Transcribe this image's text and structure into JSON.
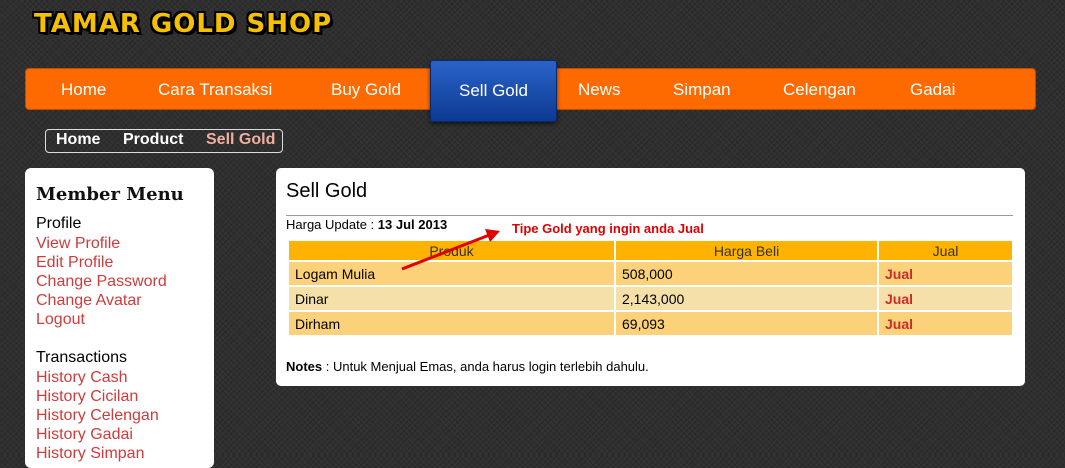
{
  "site": {
    "logo": "TAMAR GOLD SHOP"
  },
  "nav": {
    "items": [
      {
        "label": "Home"
      },
      {
        "label": "Cara Transaksi"
      },
      {
        "label": "Buy Gold"
      },
      {
        "label": "Sell Gold",
        "active": true
      },
      {
        "label": "News"
      },
      {
        "label": "Simpan"
      },
      {
        "label": "Celengan"
      },
      {
        "label": "Gadai"
      }
    ]
  },
  "breadcrumb": [
    "Home",
    "Product",
    "Sell Gold"
  ],
  "sidebar": {
    "title": "Member Menu",
    "profile": {
      "heading": "Profile",
      "links": [
        "View Profile",
        "Edit Profile",
        "Change Password",
        "Change Avatar",
        "Logout"
      ]
    },
    "transactions": {
      "heading": "Transactions",
      "links": [
        "History Cash",
        "History Cicilan",
        "History Celengan",
        "History Gadai",
        "History Simpan"
      ]
    }
  },
  "main": {
    "title": "Sell Gold",
    "update_label": "Harga Update : ",
    "update_date": "13 Jul 2013",
    "annotation": "Tipe Gold yang ingin anda Jual",
    "table": {
      "headers": [
        "Produk",
        "Harga Beli",
        "Jual"
      ],
      "rows": [
        {
          "produk": "Logam Mulia",
          "harga": "508,000",
          "action": "Jual"
        },
        {
          "produk": "Dinar",
          "harga": "2,143,000",
          "action": "Jual"
        },
        {
          "produk": "Dirham",
          "harga": "69,093",
          "action": "Jual"
        }
      ]
    },
    "notes_label": "Notes",
    "notes_text": " : Untuk Menjual Emas, anda harus login terlebih dahulu."
  },
  "colors": {
    "nav": "#ff6a00",
    "active_tab": "#1a4fb0",
    "link": "#cf3b3b",
    "table_header": "#ffb300",
    "annotation": "#e00000"
  }
}
